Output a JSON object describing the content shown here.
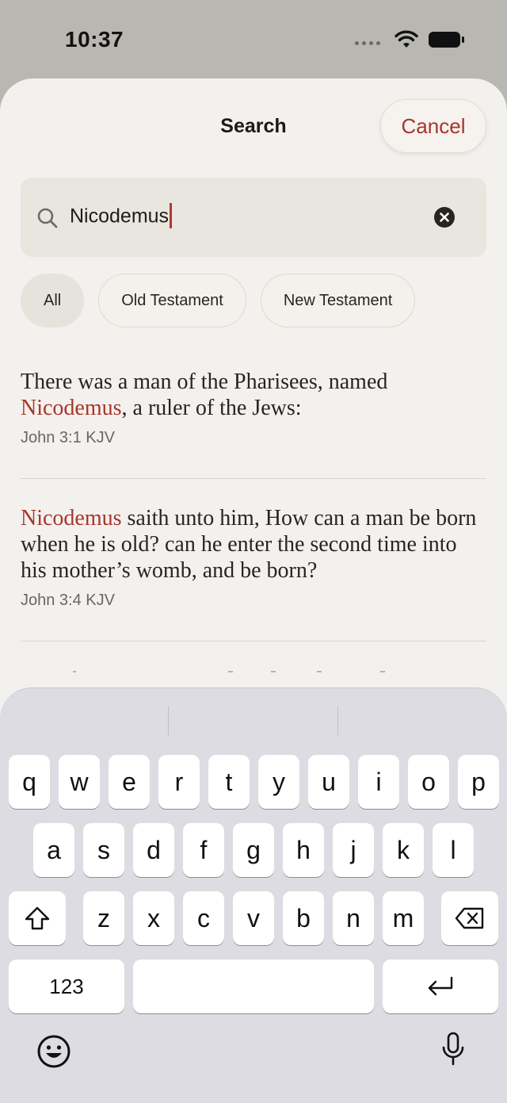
{
  "status": {
    "time": "10:37"
  },
  "header": {
    "title": "Search",
    "cancel_label": "Cancel"
  },
  "search": {
    "query": "Nicodemus"
  },
  "filters": [
    "All",
    "Old Testament",
    "New Testament"
  ],
  "results": [
    {
      "pre": "There was a man of the Pharisees, named ",
      "highlight": "Nicodemus",
      "post": ", a ruler of the Jews:",
      "reference": "John 3:1 KJV"
    },
    {
      "pre": "",
      "highlight": "Nicodemus",
      "post": " saith unto him, How can a man be born when he is old? can he enter the second time into his mother’s womb, and be born?",
      "reference": "John 3:4 KJV"
    }
  ],
  "keyboard": {
    "row1": [
      "q",
      "w",
      "e",
      "r",
      "t",
      "y",
      "u",
      "i",
      "o",
      "p"
    ],
    "row2": [
      "a",
      "s",
      "d",
      "f",
      "g",
      "h",
      "j",
      "k",
      "l"
    ],
    "row3": [
      "z",
      "x",
      "c",
      "v",
      "b",
      "n",
      "m"
    ],
    "numbers_label": "123"
  },
  "colors": {
    "accent": "#a8352a",
    "sheet_bg": "#f3f1ee",
    "keyboard_bg": "#dcdce2"
  }
}
